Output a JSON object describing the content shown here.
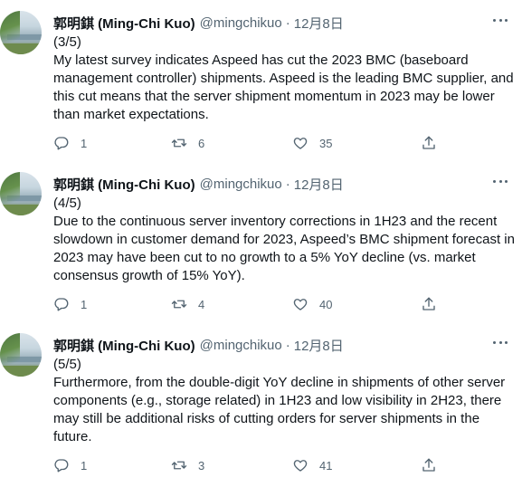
{
  "tweets": [
    {
      "author": {
        "display_name": "郭明錤 (Ming-Chi Kuo)",
        "handle": "@mingchikuo"
      },
      "separator": "·",
      "date": "12月8日",
      "counter": "(3/5)",
      "text": "My latest survey indicates Aspeed has cut the 2023 BMC (baseboard management controller) shipments. Aspeed is the leading BMC supplier, and this cut means that the server shipment momentum in 2023 may be lower than market expectations.",
      "replies": "1",
      "retweets": "6",
      "likes": "35"
    },
    {
      "author": {
        "display_name": "郭明錤 (Ming-Chi Kuo)",
        "handle": "@mingchikuo"
      },
      "separator": "·",
      "date": "12月8日",
      "counter": "(4/5)",
      "text": "Due to the continuous server inventory corrections in 1H23 and the recent slowdown in customer demand for 2023, Aspeed’s BMC shipment forecast in 2023 may have been cut to no growth to a 5% YoY decline (vs. market consensus growth of 15% YoY).",
      "replies": "1",
      "retweets": "4",
      "likes": "40"
    },
    {
      "author": {
        "display_name": "郭明錤 (Ming-Chi Kuo)",
        "handle": "@mingchikuo"
      },
      "separator": "·",
      "date": "12月8日",
      "counter": "(5/5)",
      "text": "Furthermore, from the double-digit YoY decline in shipments of other server components (e.g., storage related) in 1H23 and low visibility in 2H23, there may still be additional risks of cutting orders for server shipments in the future.",
      "replies": "1",
      "retweets": "3",
      "likes": "41"
    }
  ],
  "icons": {
    "reply": "reply-icon",
    "retweet": "retweet-icon",
    "like": "heart-icon",
    "share": "share-icon",
    "more": "more-icon"
  }
}
